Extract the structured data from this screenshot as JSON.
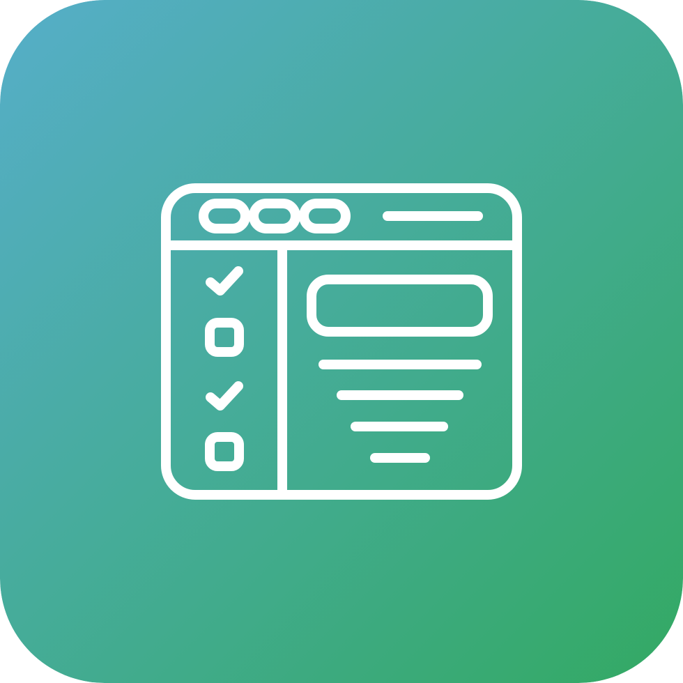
{
  "icon": {
    "name": "browser-checklist-icon",
    "gradient_start": "#56aec9",
    "gradient_end": "#33a963",
    "stroke_color": "#ffffff"
  },
  "checklist": {
    "items": [
      {
        "state": "checked"
      },
      {
        "state": "unchecked"
      },
      {
        "state": "checked"
      },
      {
        "state": "unchecked"
      }
    ]
  }
}
